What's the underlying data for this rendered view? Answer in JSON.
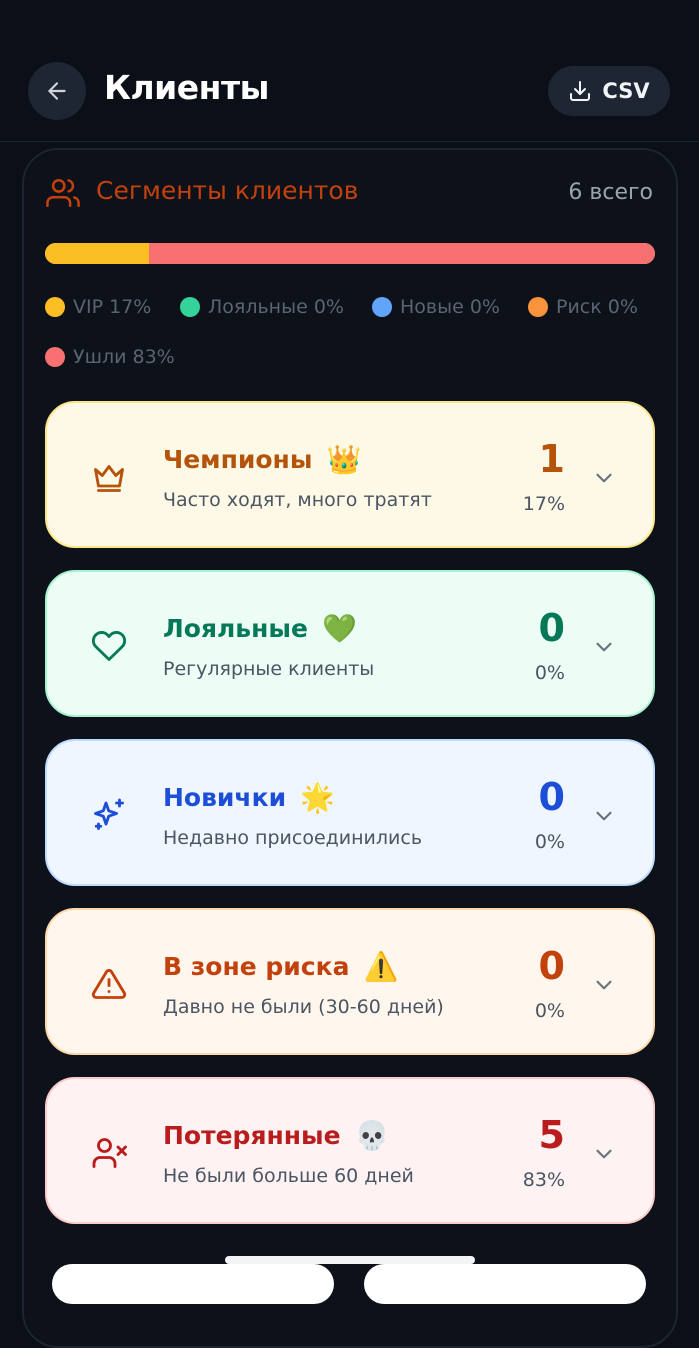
{
  "header": {
    "title": "Клиенты",
    "csv_label": "CSV"
  },
  "segments": {
    "title": "Сегменты клиентов",
    "total": "6 всего",
    "bar": [
      {
        "key": "vip",
        "fraction": 0.17,
        "color": "#fbbf24"
      },
      {
        "key": "lost",
        "fraction": 0.83,
        "color": "#f87171"
      }
    ],
    "legend": [
      {
        "label": "VIP 17%",
        "color": "#fbbf24"
      },
      {
        "label": "Лояльные 0%",
        "color": "#34d399"
      },
      {
        "label": "Новые 0%",
        "color": "#60a5fa"
      },
      {
        "label": "Риск 0%",
        "color": "#fb923c"
      },
      {
        "label": "Ушли 83%",
        "color": "#f87171"
      }
    ],
    "cards": [
      {
        "name": "Чемпионы",
        "emoji": "👑",
        "desc": "Часто ходят, много тратят",
        "count": "1",
        "pct": "17%",
        "icon": "crown-icon",
        "accent": "#b45309",
        "bg": "#fef9e7",
        "border": "#fde68a"
      },
      {
        "name": "Лояльные",
        "emoji": "💚",
        "desc": "Регулярные клиенты",
        "count": "0",
        "pct": "0%",
        "icon": "heart-icon",
        "accent": "#047857",
        "bg": "#ecfdf5",
        "border": "#a7f3d0"
      },
      {
        "name": "Новички",
        "emoji": "🌟",
        "desc": "Недавно присоединились",
        "count": "0",
        "pct": "0%",
        "icon": "sparkles-icon",
        "accent": "#1d4ed8",
        "bg": "#eff6ff",
        "border": "#bfdbfe"
      },
      {
        "name": "В зоне риска",
        "emoji": "⚠️",
        "desc": "Давно не были (30-60 дней)",
        "count": "0",
        "pct": "0%",
        "icon": "warning-icon",
        "accent": "#c2410c",
        "bg": "#fff7ed",
        "border": "#fed7aa"
      },
      {
        "name": "Потерянные",
        "emoji": "💀",
        "desc": "Не были больше 60 дней",
        "count": "5",
        "pct": "83%",
        "icon": "user-x-icon",
        "accent": "#b91c1c",
        "bg": "#fef2f2",
        "border": "#fecaca"
      }
    ]
  }
}
